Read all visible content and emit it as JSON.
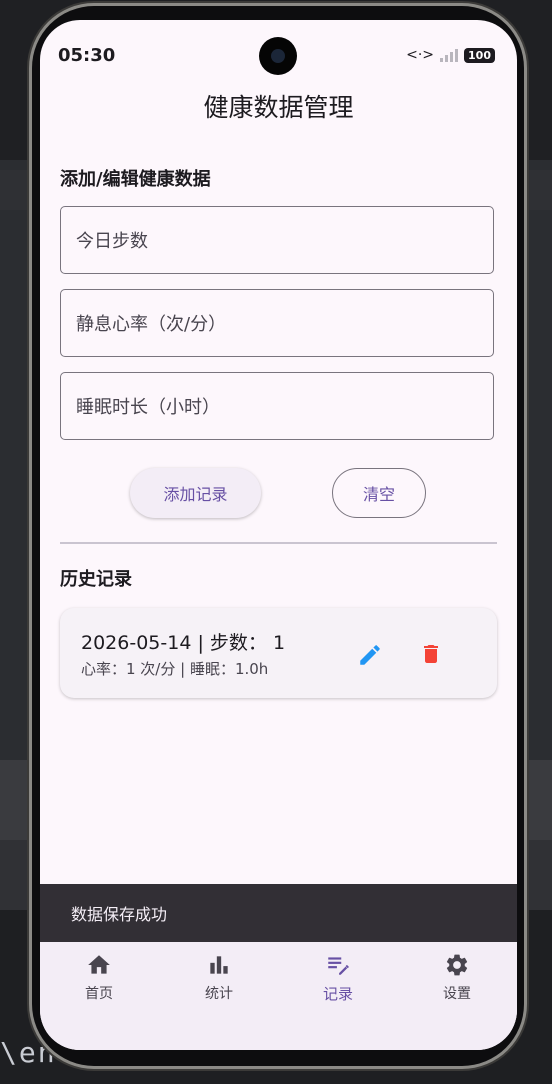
{
  "background": {
    "path_text": "\\entry"
  },
  "status_bar": {
    "time": "05:30",
    "battery": "100"
  },
  "app": {
    "title": "健康数据管理"
  },
  "form": {
    "section_title": "添加/编辑健康数据",
    "steps_placeholder": "今日步数",
    "heart_rate_placeholder": "静息心率（次/分）",
    "sleep_placeholder": "睡眠时长（小时）",
    "add_button": "添加记录",
    "clear_button": "清空"
  },
  "history": {
    "section_title": "历史记录",
    "records": [
      {
        "line1": "2026-05-14 | 步数：  1",
        "line2": "心率：1 次/分 | 睡眠：1.0h"
      }
    ]
  },
  "snackbar": {
    "message": "数据保存成功"
  },
  "bottom_nav": {
    "items": [
      {
        "label": "首页",
        "icon": "home-icon",
        "active": false
      },
      {
        "label": "统计",
        "icon": "bar-chart-icon",
        "active": false
      },
      {
        "label": "记录",
        "icon": "edit-list-icon",
        "active": true
      },
      {
        "label": "设置",
        "icon": "gear-icon",
        "active": false
      }
    ]
  },
  "colors": {
    "accent": "#6750a4",
    "edit_blue": "#2196f3",
    "delete_red": "#f44336",
    "screen_bg": "#fdf7fc"
  }
}
